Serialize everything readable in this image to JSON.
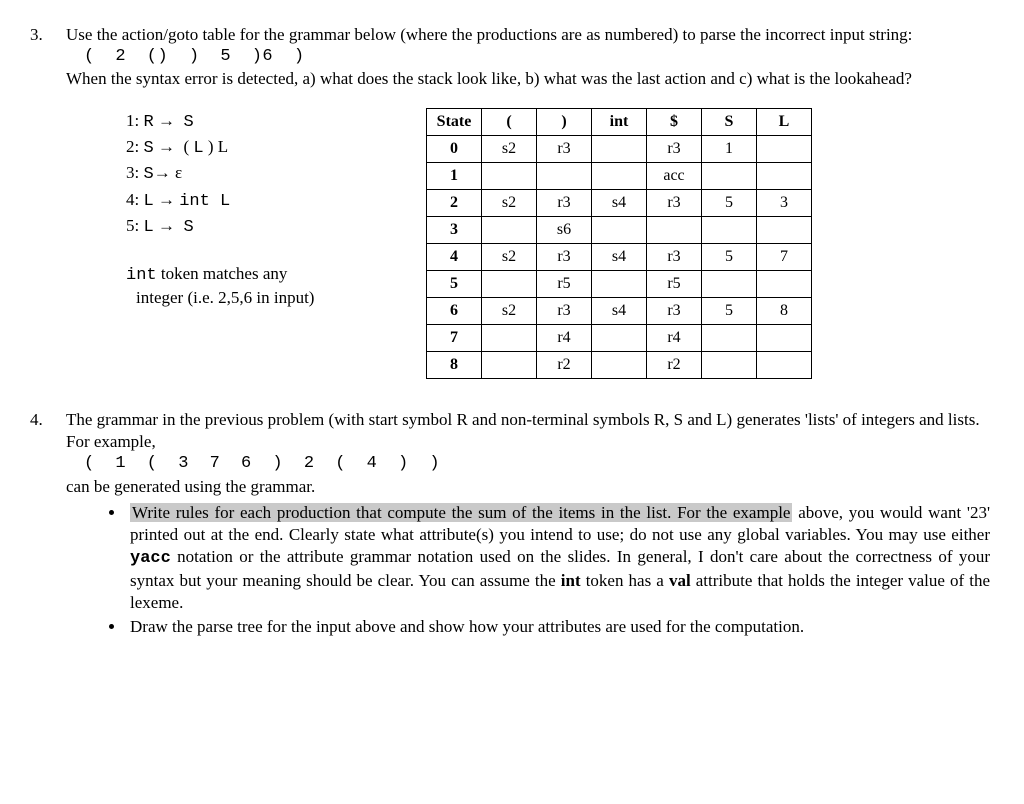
{
  "q3": {
    "number": "3.",
    "intro1": "Use the action/goto table for the grammar below (where the productions are as numbered) to parse the incorrect input string:",
    "input_tokens": "( 2 () ) 5 )6 )",
    "intro2": "When the syntax error is detected, a) what does the stack look like, b) what was the last action and c) what is the lookahead?",
    "productions": [
      {
        "n": "1:",
        "lhs": "R",
        "rhs": "S"
      },
      {
        "n": "2:",
        "lhs": "S",
        "rhs_pre": "( ",
        "rhs_mono": "L",
        "rhs_post": " ) L",
        "rhs": "( L ) L"
      },
      {
        "n": "3:",
        "lhs": "S",
        "rhs": "ε"
      },
      {
        "n": "4:",
        "lhs_mono": "L",
        "rhs_mono": "int L",
        "lhs": "L",
        "rhs": "int L"
      },
      {
        "n": "5:",
        "lhs_mono": "L",
        "lhs": "L",
        "rhs": "S"
      }
    ],
    "note1a": "int",
    "note1b": " token matches any",
    "note2": "integer (i.e. 2,5,6 in input)",
    "table": {
      "headers": [
        "State",
        "(",
        ")",
        "int",
        "$",
        "S",
        "L"
      ],
      "rows": [
        [
          "0",
          "s2",
          "r3",
          "",
          "r3",
          "1",
          ""
        ],
        [
          "1",
          "",
          "",
          "",
          "acc",
          "",
          ""
        ],
        [
          "2",
          "s2",
          "r3",
          "s4",
          "r3",
          "5",
          "3"
        ],
        [
          "3",
          "",
          "s6",
          "",
          "",
          "",
          ""
        ],
        [
          "4",
          "s2",
          "r3",
          "s4",
          "r3",
          "5",
          "7"
        ],
        [
          "5",
          "",
          "r5",
          "",
          "r5",
          "",
          ""
        ],
        [
          "6",
          "s2",
          "r3",
          "s4",
          "r3",
          "5",
          "8"
        ],
        [
          "7",
          "",
          "r4",
          "",
          "r4",
          "",
          ""
        ],
        [
          "8",
          "",
          "r2",
          "",
          "r2",
          "",
          ""
        ]
      ]
    }
  },
  "q4": {
    "number": "4.",
    "text1": "The grammar in the previous problem (with start symbol R and non-terminal symbols R, S and L) generates 'lists' of integers and lists. For example,",
    "example": "( 1 ( 3 7 6 ) 2 ( 4 ) )",
    "text2": "can be generated using the grammar.",
    "bullet1_hl": "Write rules for each production that compute the sum of the items in the list. For the example",
    "bullet1_a": "above, you would want '23' printed out at the end. Clearly state what attribute(s) you intend to use; do not use any global variables. You may use either ",
    "bullet1_yacc": "yacc",
    "bullet1_b": " notation or the attribute grammar notation used on the slides. In general, I don't care about the correctness of your syntax but your meaning should be clear. You can assume the ",
    "bullet1_int": "int",
    "bullet1_c": " token has a ",
    "bullet1_val": "val",
    "bullet1_d": " attribute that holds the integer value of the lexeme.",
    "bullet2": "Draw the parse tree for the input above and show how your attributes are used for the computation."
  }
}
